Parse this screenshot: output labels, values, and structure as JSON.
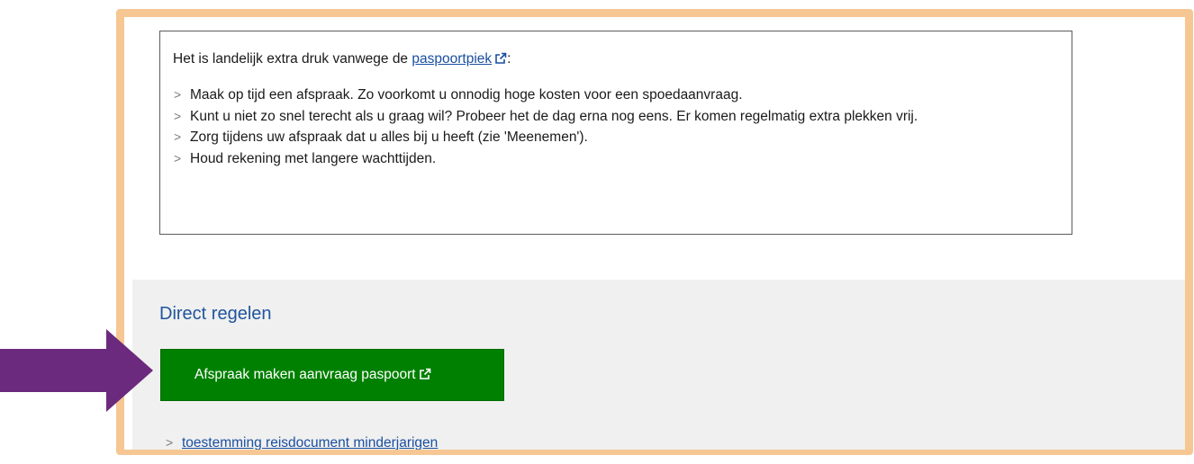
{
  "notice": {
    "intro_text": "Het is landelijk extra druk vanwege de ",
    "intro_link": "paspoortpiek",
    "intro_suffix": ":",
    "items": [
      "Maak op tijd een afspraak. Zo voorkomt u onnodig hoge kosten voor een spoedaanvraag.",
      "Kunt u niet zo snel terecht als u graag wil? Probeer het de dag erna nog eens. Er komen regelmatig extra plekken vrij.",
      "Zorg tijdens uw afspraak dat u alles bij u heeft (zie 'Meenemen').",
      "Houd rekening met langere wachttijden."
    ]
  },
  "direct": {
    "title": "Direct regelen",
    "button_label": "Afspraak maken aanvraag paspoort",
    "link_label": "toestemming reisdocument minderjarigen"
  },
  "icons": {
    "external": "external-link-icon",
    "chevron": "chevron-right-icon",
    "pointer": "arrow-right-icon"
  },
  "colors": {
    "frame": "#f6c793",
    "button": "#008000",
    "link": "#1a4fa0",
    "heading": "#20559e",
    "arrow": "#6b2a7d",
    "section_bg": "#f0f0f0"
  }
}
